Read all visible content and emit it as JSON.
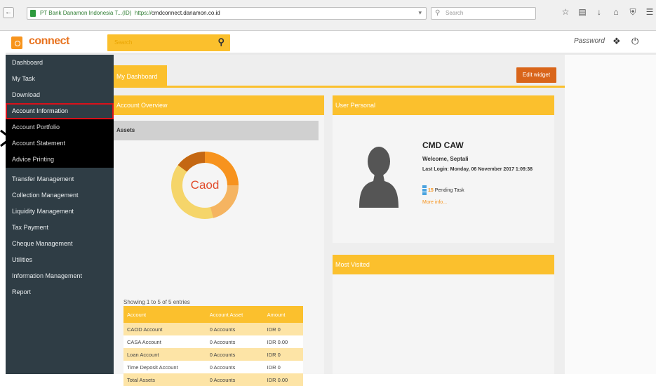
{
  "browser": {
    "url_site": "PT Bank Danamon Indonesia T...(ID)",
    "url_prefix": "https://",
    "url_host": "cmdconnect.danamon.co.id",
    "search_placeholder": "Search"
  },
  "header": {
    "logo": "connect",
    "search_placeholder": "Search",
    "user_label": "Password"
  },
  "sidebar": {
    "items": [
      {
        "label": "Dashboard"
      },
      {
        "label": "My Task"
      },
      {
        "label": "Download"
      },
      {
        "label": "Account Information"
      },
      {
        "label": "Account Portfolio"
      },
      {
        "label": "Account Statement"
      },
      {
        "label": "Advice Printing"
      },
      {
        "label": "Transfer Management"
      },
      {
        "label": "Collection Management"
      },
      {
        "label": "Liquidity Management"
      },
      {
        "label": "Tax Payment"
      },
      {
        "label": "Cheque Management"
      },
      {
        "label": "Utilities"
      },
      {
        "label": "Information Management"
      },
      {
        "label": "Report"
      }
    ]
  },
  "main": {
    "tab_label": "My Dashboard",
    "edit_label": "Edit widget"
  },
  "account_overview": {
    "title": "Account Overview",
    "assets_label": "Assets",
    "donut_label": "Caod",
    "entries_text": "Showing 1 to 5 of 5 entries",
    "columns": [
      "Account",
      "Account Asset",
      "Amount"
    ],
    "rows": [
      {
        "account": "CAOD Account",
        "asset": "0 Accounts",
        "amount": "IDR 0"
      },
      {
        "account": "CASA Account",
        "asset": "0 Accounts",
        "amount": "IDR 0.00"
      },
      {
        "account": "Loan Account",
        "asset": "0 Accounts",
        "amount": "IDR 0"
      },
      {
        "account": "Time Deposit Account",
        "asset": "0 Accounts",
        "amount": "IDR 0"
      },
      {
        "account": "Total Assets",
        "asset": "0 Accounts",
        "amount": "IDR 0.00"
      }
    ]
  },
  "user_personal": {
    "title": "User Personal",
    "name": "CMD CAW",
    "welcome": "Welcome, Septali",
    "last_login": "Last Login: Monday, 06 November 2017 1:09:38",
    "pending_count": "15",
    "pending_label": "Pending Task",
    "more_info": "More info..."
  },
  "most_visited": {
    "title": "Most Visited"
  },
  "colors": {
    "accent": "#fbc02d",
    "brand_orange": "#f7941d",
    "sidebar_bg": "#2f3d45",
    "highlight_red": "#d9111a",
    "edit_button": "#d9651a"
  }
}
